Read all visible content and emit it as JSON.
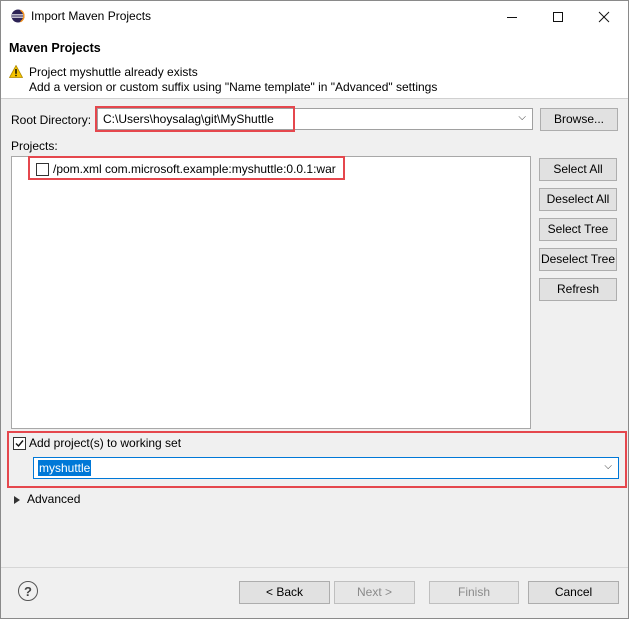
{
  "window": {
    "title": "Import Maven Projects",
    "minimize_icon": "minimize-icon",
    "maximize_icon": "maximize-icon",
    "close_icon": "close-icon"
  },
  "header": {
    "title": "Maven Projects",
    "message_line1": "Project myshuttle already exists",
    "message_line2": "Add a version or custom suffix using \"Name template\" in \"Advanced\" settings",
    "warning_icon": "warning-icon"
  },
  "root_directory": {
    "label": "Root Directory:",
    "value": "C:\\Users\\hoysalag\\git\\MyShuttle",
    "browse_label": "Browse..."
  },
  "projects": {
    "label": "Projects:",
    "items": [
      {
        "label": "/pom.xml  com.microsoft.example:myshuttle:0.0.1:war",
        "checked": false
      }
    ],
    "buttons": {
      "select_all": "Select All",
      "deselect_all": "Deselect All",
      "select_tree": "Select Tree",
      "deselect_tree": "Deselect Tree",
      "refresh": "Refresh"
    }
  },
  "working_set": {
    "label": "Add project(s) to working set",
    "checked": true,
    "value": "myshuttle"
  },
  "advanced": {
    "label": "Advanced"
  },
  "footer": {
    "back": "< Back",
    "next": "Next >",
    "finish": "Finish",
    "cancel": "Cancel",
    "help_icon": "help-icon"
  },
  "colors": {
    "highlight_border": "#e5474d",
    "selection_blue": "#0078d7",
    "focus_border": "#0078d7"
  }
}
